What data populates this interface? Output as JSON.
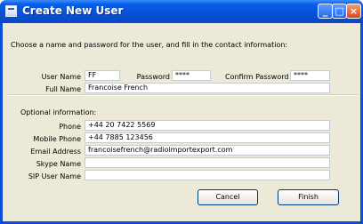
{
  "window": {
    "title": "Create New User"
  },
  "intro": "Choose a name and password for the user, and fill in the contact information:",
  "labels": {
    "user_name": "User Name",
    "password": "Password",
    "confirm_password": "Confirm Password",
    "full_name": "Full Name",
    "optional": "Optional information:",
    "phone": "Phone",
    "mobile_phone": "Mobile Phone",
    "email": "Email Address",
    "skype": "Skype Name",
    "sip": "SIP User Name"
  },
  "values": {
    "user_name": "FF",
    "password": "****",
    "confirm_password": "****",
    "full_name": "Francoise French",
    "phone": "+44 20 7422 5569",
    "mobile_phone": "+44 7885 123456",
    "email": "francoisefrench@radioimportexport.com",
    "skype": "",
    "sip": ""
  },
  "buttons": {
    "cancel": "Cancel",
    "finish": "Finish"
  }
}
